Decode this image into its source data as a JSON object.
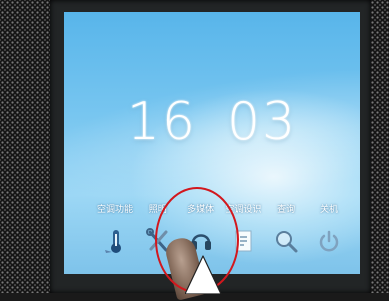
{
  "clock": {
    "hours": "16",
    "minutes": "03"
  },
  "menu": {
    "items": [
      {
        "label": "空调功能",
        "icon": "thermometer-icon"
      },
      {
        "label": "照明",
        "icon": "lighting-tools-icon"
      },
      {
        "label": "多媒体",
        "icon": "headphones-icon"
      },
      {
        "label": "空调设识",
        "icon": "document-icon"
      },
      {
        "label": "查询",
        "icon": "search-icon"
      },
      {
        "label": "关机",
        "icon": "power-icon"
      }
    ]
  },
  "highlight": {
    "target": "多媒体",
    "color": "#d2171d"
  }
}
